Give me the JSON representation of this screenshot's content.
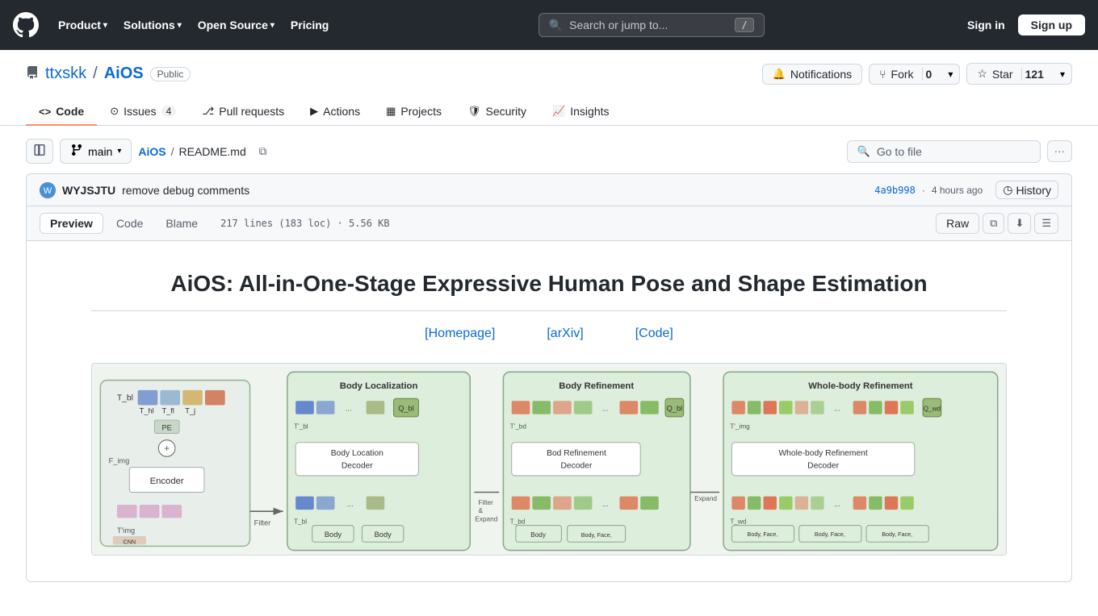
{
  "header": {
    "logo_label": "GitHub",
    "nav": [
      {
        "label": "Product",
        "has_dropdown": true
      },
      {
        "label": "Solutions",
        "has_dropdown": true
      },
      {
        "label": "Open Source",
        "has_dropdown": true
      },
      {
        "label": "Pricing",
        "has_dropdown": false
      }
    ],
    "search_placeholder": "Search or jump to...",
    "search_shortcut": "/",
    "sign_in": "Sign in",
    "sign_up": "Sign up"
  },
  "repo": {
    "owner": "ttxskk",
    "name": "AiOS",
    "visibility": "Public",
    "notifications_label": "Notifications",
    "fork_label": "Fork",
    "fork_count": "0",
    "star_label": "Star",
    "star_count": "121",
    "dropdown_icon": "▾"
  },
  "nav_tabs": [
    {
      "label": "Code",
      "icon": "code",
      "count": null,
      "active": true
    },
    {
      "label": "Issues",
      "icon": "issue",
      "count": "4",
      "active": false
    },
    {
      "label": "Pull requests",
      "icon": "pr",
      "count": null,
      "active": false
    },
    {
      "label": "Actions",
      "icon": "actions",
      "count": null,
      "active": false
    },
    {
      "label": "Projects",
      "icon": "projects",
      "count": null,
      "active": false
    },
    {
      "label": "Security",
      "icon": "security",
      "count": null,
      "active": false
    },
    {
      "label": "Insights",
      "icon": "insights",
      "count": null,
      "active": false
    }
  ],
  "toolbar": {
    "branch": "main",
    "breadcrumb_root": "AiOS",
    "breadcrumb_file": "README.md",
    "copy_tooltip": "Copy path",
    "go_to_file_placeholder": "Go to file",
    "more_options": "More options"
  },
  "commit": {
    "author": "WYJSJTU",
    "message": "remove debug comments",
    "hash": "4a9b998",
    "time": "4 hours ago",
    "history_label": "History"
  },
  "file_view": {
    "tabs": [
      {
        "label": "Preview",
        "active": true
      },
      {
        "label": "Code",
        "active": false
      },
      {
        "label": "Blame",
        "active": false
      }
    ],
    "file_info": "217 lines (183 loc) · 5.56 KB",
    "raw_label": "Raw"
  },
  "readme": {
    "title": "AiOS: All-in-One-Stage Expressive Human Pose and Shape Estimation",
    "links": [
      {
        "label": "[Homepage]",
        "url": "#"
      },
      {
        "label": "[arXiv]",
        "url": "#"
      },
      {
        "label": "[Code]",
        "url": "#"
      }
    ],
    "diagram": {
      "modules": [
        {
          "title": "Body Localization",
          "blocks": [
            "Body Location",
            "Decoder"
          ]
        },
        {
          "title": "Body Refinement",
          "blocks": [
            "Bod Refinement",
            "Decoder"
          ]
        },
        {
          "title": "Whole-body Refinement",
          "blocks": [
            "Whole-body Refinement",
            "Decoder"
          ]
        }
      ]
    }
  },
  "icons": {
    "search": "🔍",
    "code": "<>",
    "issue": "⊙",
    "pr": "⎇",
    "actions": "▶",
    "projects": "▦",
    "security": "🛡",
    "insights": "📈",
    "branch": "⎇",
    "sidebar": "☰",
    "copy": "⧉",
    "history": "◷",
    "raw": "📄",
    "download": "⬇",
    "list": "☰"
  }
}
